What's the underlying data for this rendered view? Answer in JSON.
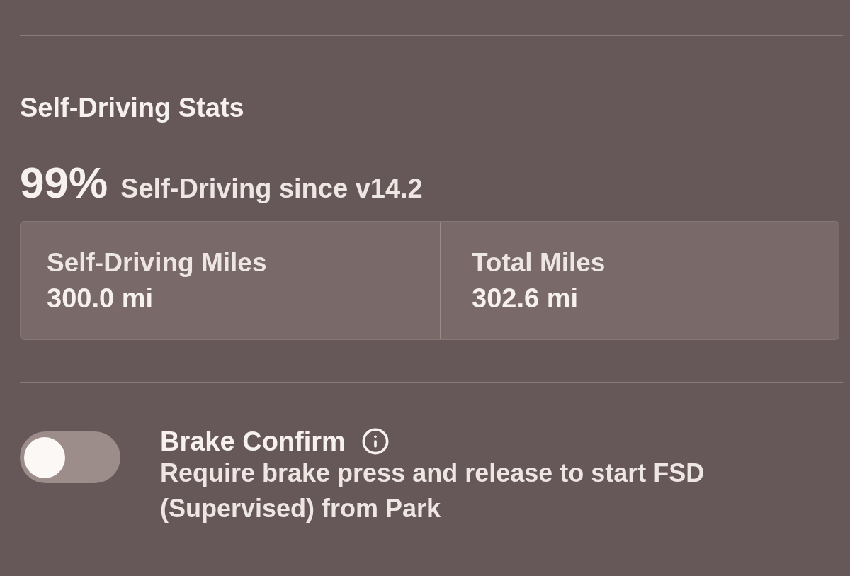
{
  "section": {
    "title": "Self-Driving Stats",
    "percent": "99%",
    "percent_caption": "Self-Driving since v14.2",
    "stats": [
      {
        "label": "Self-Driving Miles",
        "value": "300.0 mi"
      },
      {
        "label": "Total Miles",
        "value": "302.6 mi"
      }
    ]
  },
  "setting": {
    "title": "Brake Confirm",
    "description": "Require brake press and release to start FSD (Supervised) from Park",
    "on": false
  }
}
